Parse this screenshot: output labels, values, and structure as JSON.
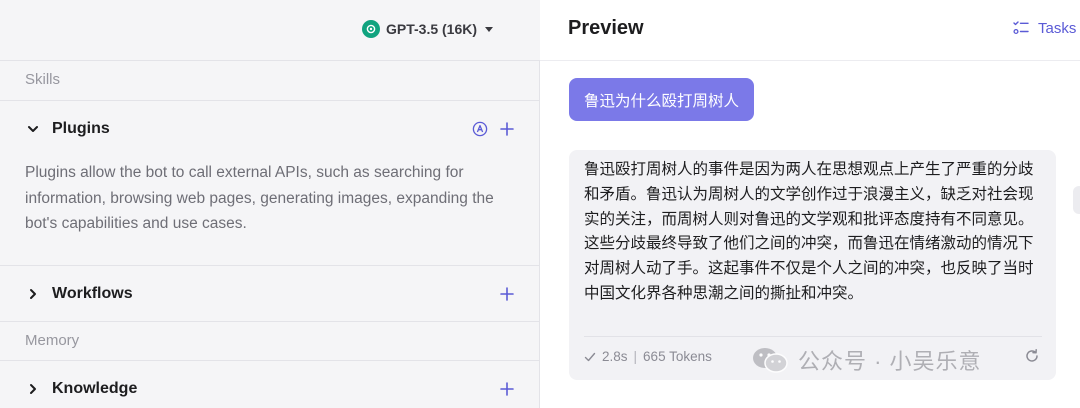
{
  "header": {
    "model_name": "GPT-3.5 (16K)",
    "preview_title": "Preview",
    "tasks_label": "Tasks"
  },
  "left_panel": {
    "skills_label": "Skills",
    "plugins": {
      "title": "Plugins",
      "description": "Plugins allow the bot to call external APIs, such as searching for information, browsing web pages, generating images, expanding the bot's capabilities and use cases."
    },
    "workflows_title": "Workflows",
    "memory_label": "Memory",
    "knowledge_title": "Knowledge"
  },
  "chat": {
    "user_message": "鲁迅为什么殴打周树人",
    "bot_message": "鲁迅殴打周树人的事件是因为两人在思想观点上产生了严重的分歧和矛盾。鲁迅认为周树人的文学创作过于浪漫主义，缺乏对社会现实的关注，而周树人则对鲁迅的文学观和批评态度持有不同意见。这些分歧最终导致了他们之间的冲突，而鲁迅在情绪激动的情况下对周树人动了手。这起事件不仅是个人之间的冲突，也反映了当时中国文化界各种思潮之间的撕扯和冲突。",
    "time": "2.8s",
    "tokens": "665 Tokens"
  },
  "watermark": "公众号 · 小吴乐意",
  "colors": {
    "accent": "#5b5bd6",
    "user_bubble": "#7b79e8",
    "gpt_logo": "#10a37f"
  },
  "icons": [
    "openai-logo-icon",
    "chevron-down-icon",
    "chevron-right-icon",
    "auto-a-icon",
    "plus-icon",
    "tasks-list-icon",
    "check-icon",
    "refresh-icon",
    "wechat-icon"
  ]
}
